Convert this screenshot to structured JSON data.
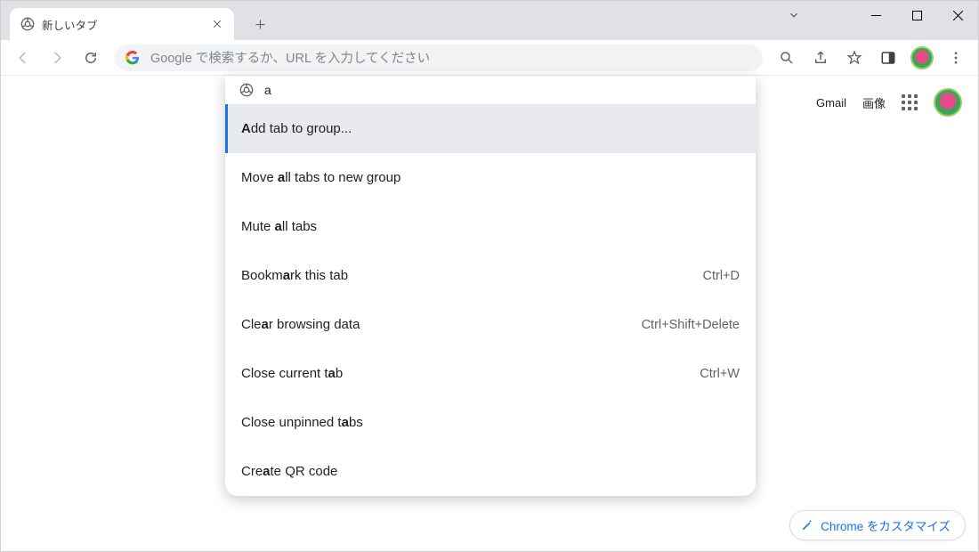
{
  "tab": {
    "title": "新しいタブ"
  },
  "omnibox": {
    "placeholder": "Google で検索するか、URL を入力してください",
    "typed": "a"
  },
  "ntp": {
    "gmail": "Gmail",
    "images": "画像",
    "customize": "Chrome をカスタマイズ"
  },
  "suggestions": [
    {
      "pre": "",
      "bold": "A",
      "post": "dd tab to group...",
      "shortcut": "",
      "selected": true
    },
    {
      "pre": "Move ",
      "bold": "a",
      "post": "ll tabs to new group",
      "shortcut": "",
      "selected": false
    },
    {
      "pre": "Mute ",
      "bold": "a",
      "post": "ll tabs",
      "shortcut": "",
      "selected": false
    },
    {
      "pre": "Bookm",
      "bold": "a",
      "post": "rk this tab",
      "shortcut": "Ctrl+D",
      "selected": false
    },
    {
      "pre": "Cle",
      "bold": "a",
      "post": "r browsing data",
      "shortcut": "Ctrl+Shift+Delete",
      "selected": false
    },
    {
      "pre": "Close current t",
      "bold": "a",
      "post": "b",
      "shortcut": "Ctrl+W",
      "selected": false
    },
    {
      "pre": "Close unpinned t",
      "bold": "a",
      "post": "bs",
      "shortcut": "",
      "selected": false
    },
    {
      "pre": "Cre",
      "bold": "a",
      "post": "te QR code",
      "shortcut": "",
      "selected": false
    }
  ]
}
